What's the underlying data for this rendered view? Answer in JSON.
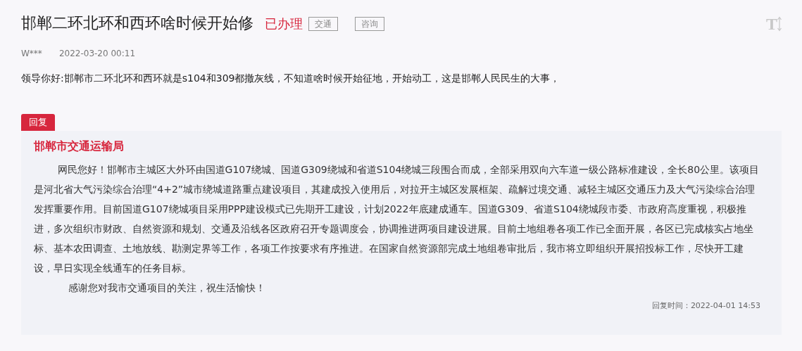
{
  "title": "邯郸二环北环和西环啥时候开始修",
  "status": "已办理",
  "tags": [
    {
      "label": "交通"
    },
    {
      "label": "咨询"
    }
  ],
  "font_size_button": {
    "label": "T"
  },
  "author": "W***",
  "date": "2022-03-20 00:11",
  "question": "领导你好:邯郸市二环北环和西环就是s104和309都撤灰线，不知道啥时候开始征地，开始动工，这是邯郸人民民生的大事，",
  "reply": {
    "tab": "回复",
    "department": "邯郸市交通运输局",
    "paragraphs": [
      "网民您好！邯郸市主城区大外环由国道G107绕城、国道G309绕城和省道S104绕城三段围合而成，全部采用双向六车道一级公路标准建设，全长80公里。该项目是河北省大气污染综合治理“4+2”城市绕城道路重点建设项目，其建成投入使用后，对拉开主城区发展框架、疏解过境交通、减轻主城区交通压力及大气污染综合治理发挥重要作用。目前国道G107绕城项目采用PPP建设模式已先期开工建设，计划2022年底建成通车。国道G309、省道S104绕城段市委、市政府高度重视，积极推进，多次组织市财政、自然资源和规划、交通及沿线各区政府召开专题调度会，协调推进两项目建设进展。目前土地组卷各项工作已全面开展，各区已完成核实占地坐标、基本农田调查、土地放线、勘测定界等工作，各项工作按要求有序推进。在国家自然资源部完成土地组卷审批后，我市将立即组织开展招投标工作，尽快开工建设，早日实现全线通车的任务目标。",
      "感谢您对我市交通项目的关注，祝生活愉快！"
    ],
    "time": "回复时间：2022-04-01 14:53"
  }
}
